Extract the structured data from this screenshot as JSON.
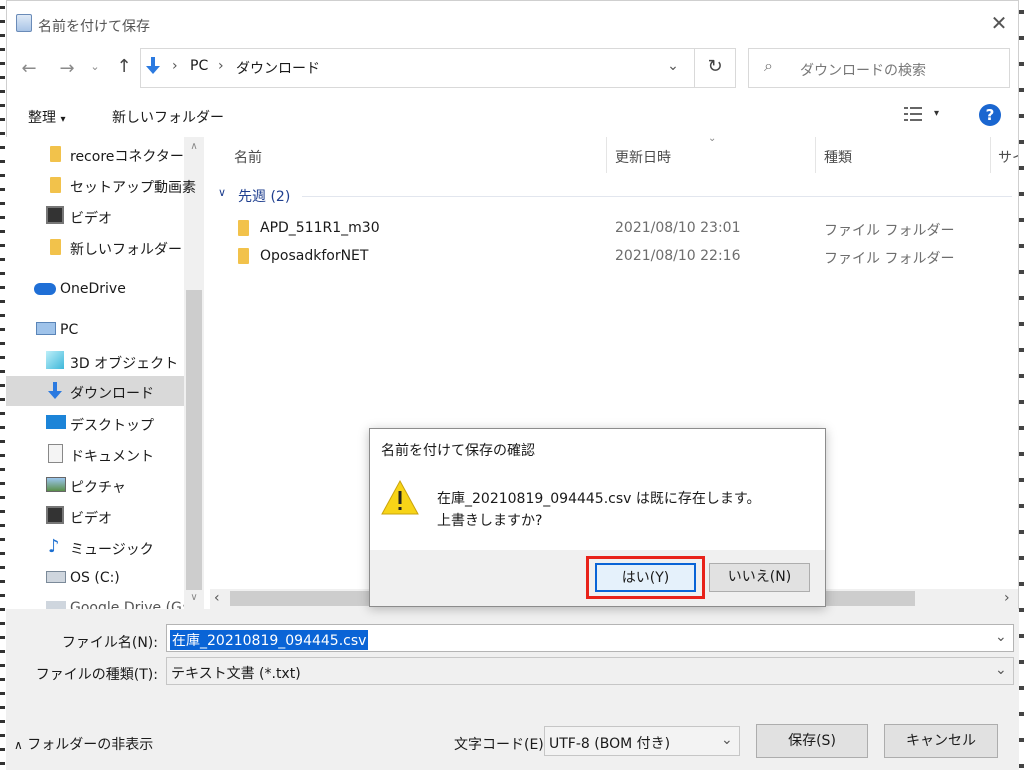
{
  "window": {
    "title": "名前を付けて保存"
  },
  "address": {
    "root": "PC",
    "current": "ダウンロード"
  },
  "search": {
    "placeholder": "ダウンロードの検索"
  },
  "toolbar": {
    "organize": "整理",
    "new_folder": "新しいフォルダー"
  },
  "sidebar": {
    "items": [
      {
        "label": "recoreコネクター",
        "icon": "folder-icon"
      },
      {
        "label": "セットアップ動画素",
        "icon": "folder-icon"
      },
      {
        "label": "ビデオ",
        "icon": "video-icon"
      },
      {
        "label": "新しいフォルダー",
        "icon": "folder-icon"
      },
      {
        "label": "OneDrive",
        "icon": "cloud-icon"
      },
      {
        "label": "PC",
        "icon": "pc-icon"
      },
      {
        "label": "3D オブジェクト",
        "icon": "cube-icon"
      },
      {
        "label": "ダウンロード",
        "icon": "download-icon"
      },
      {
        "label": "デスクトップ",
        "icon": "desktop-icon"
      },
      {
        "label": "ドキュメント",
        "icon": "document-icon"
      },
      {
        "label": "ピクチャ",
        "icon": "picture-icon"
      },
      {
        "label": "ビデオ",
        "icon": "video-icon"
      },
      {
        "label": "ミュージック",
        "icon": "music-icon"
      },
      {
        "label": "OS (C:)",
        "icon": "drive-icon"
      },
      {
        "label": "Google Drive (G:",
        "icon": "drive-icon"
      }
    ]
  },
  "columns": {
    "name": "名前",
    "date": "更新日時",
    "type": "種類",
    "size": "サイ"
  },
  "group": {
    "label": "先週 (2)"
  },
  "files": [
    {
      "name": "APD_511R1_m30",
      "date": "2021/08/10 23:01",
      "type": "ファイル フォルダー"
    },
    {
      "name": "OposadkforNET",
      "date": "2021/08/10 22:16",
      "type": "ファイル フォルダー"
    }
  ],
  "form": {
    "filename_label": "ファイル名(N):",
    "filename_value": "在庫_20210819_094445.csv",
    "filetype_label": "ファイルの種類(T):",
    "filetype_value": "テキスト文書 (*.txt)",
    "hide_folders": "フォルダーの非表示",
    "encoding_label": "文字コード(E):",
    "encoding_value": "UTF-8 (BOM 付き)",
    "save": "保存(S)",
    "cancel": "キャンセル"
  },
  "dialog": {
    "title": "名前を付けて保存の確認",
    "message_line1": "在庫_20210819_094445.csv は既に存在します。",
    "message_line2": "上書きしますか?",
    "yes": "はい(Y)",
    "no": "いいえ(N)"
  },
  "colors": {
    "accent": "#0a64d6",
    "highlight": "#e8221a",
    "warning": "#f7d417"
  }
}
